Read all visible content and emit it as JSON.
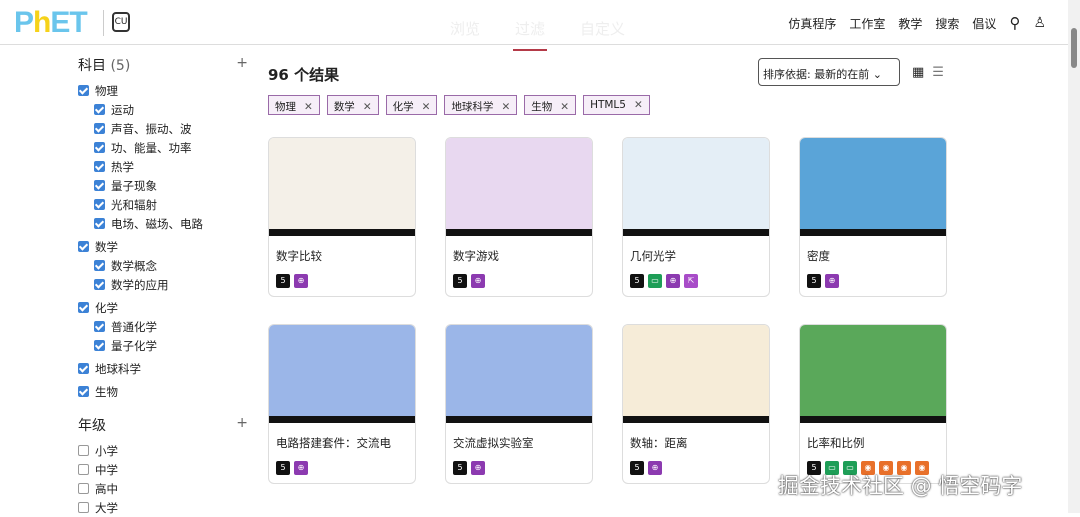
{
  "header": {
    "logo": "PhET",
    "tabs": [
      "浏览",
      "过滤",
      "自定义"
    ],
    "nav": [
      "仿真程序",
      "工作室",
      "教学",
      "搜索",
      "倡议"
    ]
  },
  "sidebar": {
    "subject": {
      "title": "科目",
      "count": "(5)",
      "items": [
        {
          "label": "物理",
          "checked": true,
          "children": [
            "运动",
            "声音、振动、波",
            "功、能量、功率",
            "热学",
            "量子现象",
            "光和辐射",
            "电场、磁场、电路"
          ]
        },
        {
          "label": "数学",
          "checked": true,
          "children": [
            "数学概念",
            "数学的应用"
          ]
        },
        {
          "label": "化学",
          "checked": true,
          "children": [
            "普通化学",
            "量子化学"
          ]
        },
        {
          "label": "地球科学",
          "checked": true,
          "children": []
        },
        {
          "label": "生物",
          "checked": true,
          "children": []
        }
      ]
    },
    "grade": {
      "title": "年级",
      "items": [
        "小学",
        "中学",
        "高中",
        "大学"
      ]
    }
  },
  "results": {
    "count": "96 个结果",
    "sort": "排序依据:  最新的在前",
    "chips": [
      "物理",
      "数学",
      "化学",
      "地球科学",
      "生物",
      "HTML5"
    ]
  },
  "cards": [
    {
      "title": "数字比较",
      "icons": [
        "h5",
        "zm"
      ],
      "color": "#f4f0e8"
    },
    {
      "title": "数字游戏",
      "icons": [
        "h5",
        "zm"
      ],
      "color": "#e8d8f0"
    },
    {
      "title": "几何光学",
      "icons": [
        "h5",
        "kb",
        "zm",
        "ms"
      ],
      "color": "#e4eef6"
    },
    {
      "title": "密度",
      "icons": [
        "h5",
        "zm"
      ],
      "color": "#5aa4d8"
    },
    {
      "title": "电路搭建套件：交流电",
      "icons": [
        "h5",
        "zm"
      ],
      "color": "#9bb6e8"
    },
    {
      "title": "交流虚拟实验室",
      "icons": [
        "h5",
        "zm"
      ],
      "color": "#9bb6e8"
    },
    {
      "title": "数轴：距离",
      "icons": [
        "h5",
        "zm"
      ],
      "color": "#f6ecd8"
    },
    {
      "title": "比率和比例",
      "icons": [
        "h5",
        "kb",
        "kb",
        "or",
        "or",
        "or",
        "or"
      ],
      "color": "#5aa85a"
    }
  ],
  "watermark": "掘金技术社区 @ 悟空码字"
}
